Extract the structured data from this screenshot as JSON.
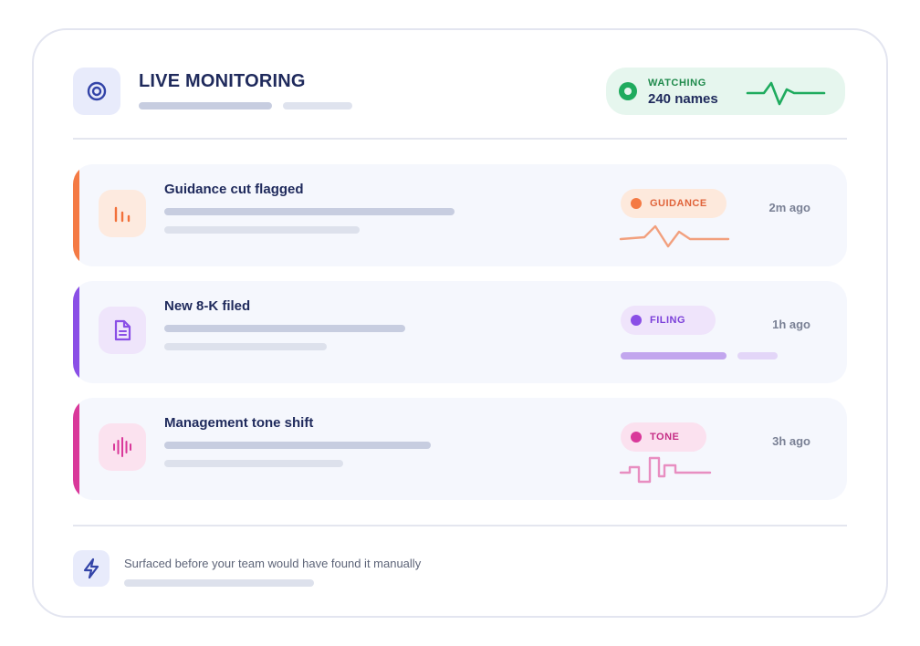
{
  "header": {
    "title": "LIVE MONITORING",
    "icon": "target-icon"
  },
  "status": {
    "label": "WATCHING",
    "count": "240 names",
    "icon": "pulse-icon",
    "color": "#1fab5e"
  },
  "alerts": [
    {
      "title": "Guidance cut flagged",
      "tag": "GUIDANCE",
      "time": "2m ago",
      "icon": "bar-chart-icon",
      "accent": "#f47a44",
      "tag_bg": "#fde9dc",
      "tag_text": "#e0633a",
      "icon_bg": "#fdeadf"
    },
    {
      "title": "New 8-K filed",
      "tag": "FILING",
      "time": "1h ago",
      "icon": "document-icon",
      "accent": "#8a4fe6",
      "tag_bg": "#efe4fb",
      "tag_text": "#7b3fd9",
      "icon_bg": "#efe5fb"
    },
    {
      "title": "Management tone shift",
      "tag": "TONE",
      "time": "3h ago",
      "icon": "waveform-icon",
      "accent": "#d9389a",
      "tag_bg": "#fbe1ef",
      "tag_text": "#c52d85",
      "icon_bg": "#fbe2ef"
    }
  ],
  "footer": {
    "text": "Surfaced before your team would have found it manually",
    "icon": "lightning-icon"
  }
}
